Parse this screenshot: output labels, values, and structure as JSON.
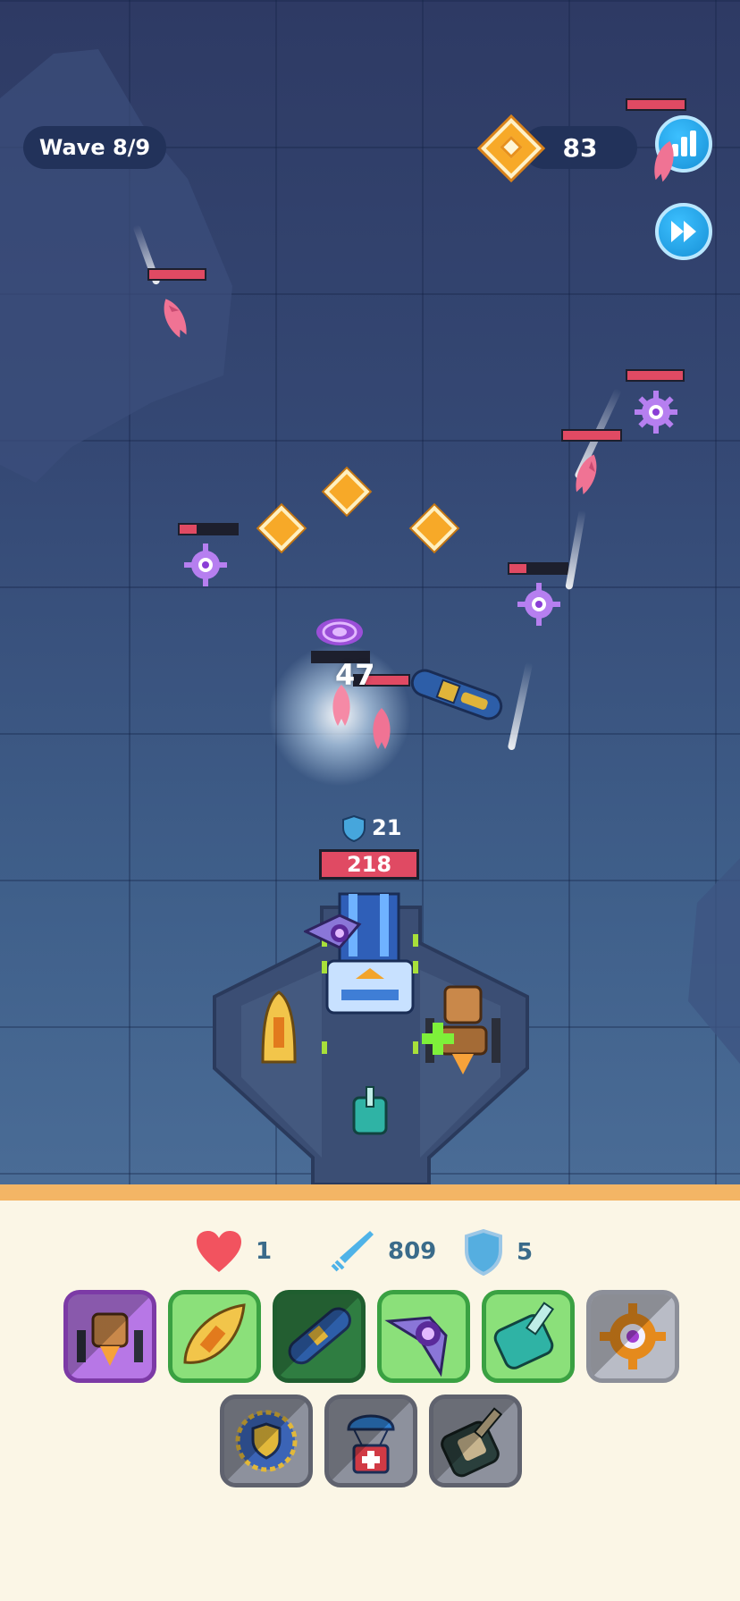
{
  "hud": {
    "wave_label": "Wave 8/9",
    "gold_count": "83",
    "stats_icon": "bar-chart-icon",
    "fast_forward_icon": "fast-forward-icon"
  },
  "battle": {
    "damage_popup": "47",
    "base_shield_value": "21",
    "base_hp": "218"
  },
  "panel": {
    "lives": "1",
    "attack": "809",
    "defense": "5",
    "row1_slots": [
      {
        "name": "mech-walker-unit",
        "style": "purple"
      },
      {
        "name": "golden-boat-unit",
        "style": "green"
      },
      {
        "name": "blue-submarine-unit",
        "style": "darkgreen"
      },
      {
        "name": "vortex-glider-unit",
        "style": "green"
      },
      {
        "name": "teal-tank-unit",
        "style": "green"
      },
      {
        "name": "spiral-gear-unit",
        "style": "grey"
      }
    ],
    "row2_slots": [
      {
        "name": "shield-orb-unit",
        "style": "darkgrey"
      },
      {
        "name": "medkit-drop-unit",
        "style": "darkgrey"
      },
      {
        "name": "turret-tank-unit",
        "style": "darkgrey"
      }
    ]
  },
  "colors": {
    "accent_blue": "#1790d6",
    "gold": "#f7a928",
    "hp_red": "#e04a63",
    "panel_bg": "#fbf6e6",
    "panel_border": "#f3b565"
  }
}
